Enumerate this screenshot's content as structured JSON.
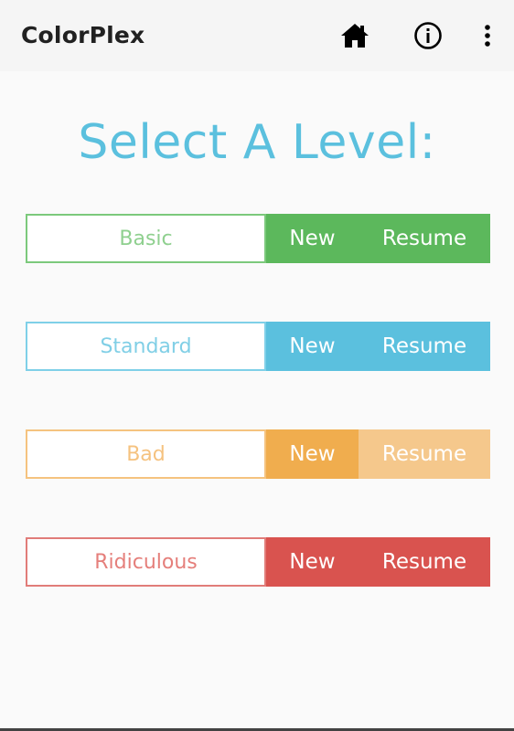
{
  "app_bar": {
    "title": "ColorPlex",
    "actions": [
      {
        "icon": "home-icon"
      },
      {
        "icon": "info-icon"
      },
      {
        "icon": "more-vert-icon"
      }
    ]
  },
  "headline": "Select A Level:",
  "levels": [
    {
      "name": "Basic",
      "new_label": "New",
      "resume_label": "Resume",
      "colors": {
        "border": "#7cc97c",
        "text": "#8fd08f",
        "new_bg": "#5cb85c",
        "resume_bg": "#5cb85c"
      }
    },
    {
      "name": "Standard",
      "new_label": "New",
      "resume_label": "Resume",
      "colors": {
        "border": "#7fd0e8",
        "text": "#80cfe6",
        "new_bg": "#5bc0de",
        "resume_bg": "#5bc0de"
      }
    },
    {
      "name": "Bad",
      "new_label": "New",
      "resume_label": "Resume",
      "colors": {
        "border": "#f5c37f",
        "text": "#f5c27f",
        "new_bg": "#f0ad4e",
        "resume_bg": "#f5c88c"
      }
    },
    {
      "name": "Ridiculous",
      "new_label": "New",
      "resume_label": "Resume",
      "colors": {
        "border": "#e17c79",
        "text": "#e57f7b",
        "new_bg": "#d9534f",
        "resume_bg": "#d9534f"
      }
    }
  ]
}
